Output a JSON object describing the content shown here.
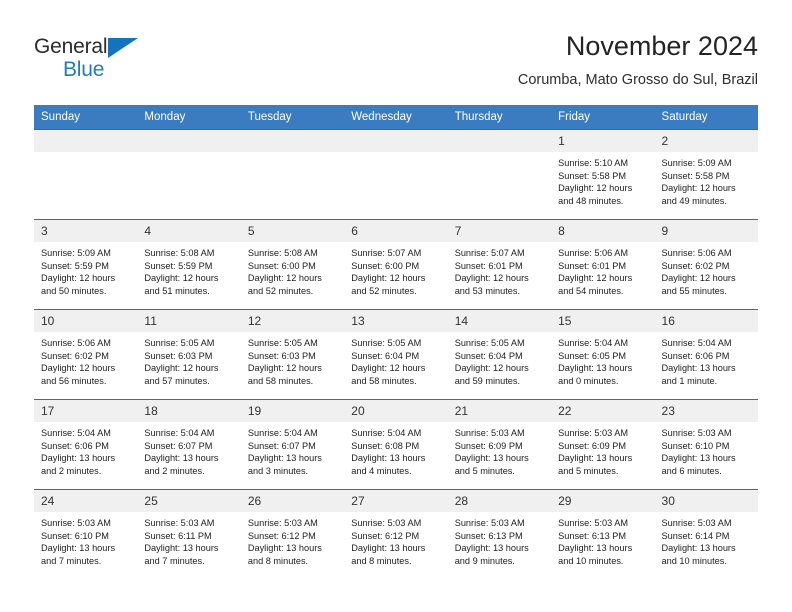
{
  "brand": {
    "name_top": "General",
    "name_bottom": "Blue",
    "color_dark": "#2b2b2b",
    "color_blue": "#1f7dc4"
  },
  "header": {
    "title": "November 2024",
    "subtitle": "Corumba, Mato Grosso do Sul, Brazil"
  },
  "theme": {
    "header_bg": "#3b7cc0",
    "row_border": "#2f6fab",
    "daynum_bg": "#f0f0f0"
  },
  "calendar": {
    "weekday_headers": [
      "Sunday",
      "Monday",
      "Tuesday",
      "Wednesday",
      "Thursday",
      "Friday",
      "Saturday"
    ],
    "weeks": [
      [
        {
          "day": "",
          "empty": true
        },
        {
          "day": "",
          "empty": true
        },
        {
          "day": "",
          "empty": true
        },
        {
          "day": "",
          "empty": true
        },
        {
          "day": "",
          "empty": true
        },
        {
          "day": "1",
          "sunrise": "Sunrise: 5:10 AM",
          "sunset": "Sunset: 5:58 PM",
          "daylight1": "Daylight: 12 hours",
          "daylight2": "and 48 minutes."
        },
        {
          "day": "2",
          "sunrise": "Sunrise: 5:09 AM",
          "sunset": "Sunset: 5:58 PM",
          "daylight1": "Daylight: 12 hours",
          "daylight2": "and 49 minutes."
        }
      ],
      [
        {
          "day": "3",
          "sunrise": "Sunrise: 5:09 AM",
          "sunset": "Sunset: 5:59 PM",
          "daylight1": "Daylight: 12 hours",
          "daylight2": "and 50 minutes."
        },
        {
          "day": "4",
          "sunrise": "Sunrise: 5:08 AM",
          "sunset": "Sunset: 5:59 PM",
          "daylight1": "Daylight: 12 hours",
          "daylight2": "and 51 minutes."
        },
        {
          "day": "5",
          "sunrise": "Sunrise: 5:08 AM",
          "sunset": "Sunset: 6:00 PM",
          "daylight1": "Daylight: 12 hours",
          "daylight2": "and 52 minutes."
        },
        {
          "day": "6",
          "sunrise": "Sunrise: 5:07 AM",
          "sunset": "Sunset: 6:00 PM",
          "daylight1": "Daylight: 12 hours",
          "daylight2": "and 52 minutes."
        },
        {
          "day": "7",
          "sunrise": "Sunrise: 5:07 AM",
          "sunset": "Sunset: 6:01 PM",
          "daylight1": "Daylight: 12 hours",
          "daylight2": "and 53 minutes."
        },
        {
          "day": "8",
          "sunrise": "Sunrise: 5:06 AM",
          "sunset": "Sunset: 6:01 PM",
          "daylight1": "Daylight: 12 hours",
          "daylight2": "and 54 minutes."
        },
        {
          "day": "9",
          "sunrise": "Sunrise: 5:06 AM",
          "sunset": "Sunset: 6:02 PM",
          "daylight1": "Daylight: 12 hours",
          "daylight2": "and 55 minutes."
        }
      ],
      [
        {
          "day": "10",
          "sunrise": "Sunrise: 5:06 AM",
          "sunset": "Sunset: 6:02 PM",
          "daylight1": "Daylight: 12 hours",
          "daylight2": "and 56 minutes."
        },
        {
          "day": "11",
          "sunrise": "Sunrise: 5:05 AM",
          "sunset": "Sunset: 6:03 PM",
          "daylight1": "Daylight: 12 hours",
          "daylight2": "and 57 minutes."
        },
        {
          "day": "12",
          "sunrise": "Sunrise: 5:05 AM",
          "sunset": "Sunset: 6:03 PM",
          "daylight1": "Daylight: 12 hours",
          "daylight2": "and 58 minutes."
        },
        {
          "day": "13",
          "sunrise": "Sunrise: 5:05 AM",
          "sunset": "Sunset: 6:04 PM",
          "daylight1": "Daylight: 12 hours",
          "daylight2": "and 58 minutes."
        },
        {
          "day": "14",
          "sunrise": "Sunrise: 5:05 AM",
          "sunset": "Sunset: 6:04 PM",
          "daylight1": "Daylight: 12 hours",
          "daylight2": "and 59 minutes."
        },
        {
          "day": "15",
          "sunrise": "Sunrise: 5:04 AM",
          "sunset": "Sunset: 6:05 PM",
          "daylight1": "Daylight: 13 hours",
          "daylight2": "and 0 minutes."
        },
        {
          "day": "16",
          "sunrise": "Sunrise: 5:04 AM",
          "sunset": "Sunset: 6:06 PM",
          "daylight1": "Daylight: 13 hours",
          "daylight2": "and 1 minute."
        }
      ],
      [
        {
          "day": "17",
          "sunrise": "Sunrise: 5:04 AM",
          "sunset": "Sunset: 6:06 PM",
          "daylight1": "Daylight: 13 hours",
          "daylight2": "and 2 minutes."
        },
        {
          "day": "18",
          "sunrise": "Sunrise: 5:04 AM",
          "sunset": "Sunset: 6:07 PM",
          "daylight1": "Daylight: 13 hours",
          "daylight2": "and 2 minutes."
        },
        {
          "day": "19",
          "sunrise": "Sunrise: 5:04 AM",
          "sunset": "Sunset: 6:07 PM",
          "daylight1": "Daylight: 13 hours",
          "daylight2": "and 3 minutes."
        },
        {
          "day": "20",
          "sunrise": "Sunrise: 5:04 AM",
          "sunset": "Sunset: 6:08 PM",
          "daylight1": "Daylight: 13 hours",
          "daylight2": "and 4 minutes."
        },
        {
          "day": "21",
          "sunrise": "Sunrise: 5:03 AM",
          "sunset": "Sunset: 6:09 PM",
          "daylight1": "Daylight: 13 hours",
          "daylight2": "and 5 minutes."
        },
        {
          "day": "22",
          "sunrise": "Sunrise: 5:03 AM",
          "sunset": "Sunset: 6:09 PM",
          "daylight1": "Daylight: 13 hours",
          "daylight2": "and 5 minutes."
        },
        {
          "day": "23",
          "sunrise": "Sunrise: 5:03 AM",
          "sunset": "Sunset: 6:10 PM",
          "daylight1": "Daylight: 13 hours",
          "daylight2": "and 6 minutes."
        }
      ],
      [
        {
          "day": "24",
          "sunrise": "Sunrise: 5:03 AM",
          "sunset": "Sunset: 6:10 PM",
          "daylight1": "Daylight: 13 hours",
          "daylight2": "and 7 minutes."
        },
        {
          "day": "25",
          "sunrise": "Sunrise: 5:03 AM",
          "sunset": "Sunset: 6:11 PM",
          "daylight1": "Daylight: 13 hours",
          "daylight2": "and 7 minutes."
        },
        {
          "day": "26",
          "sunrise": "Sunrise: 5:03 AM",
          "sunset": "Sunset: 6:12 PM",
          "daylight1": "Daylight: 13 hours",
          "daylight2": "and 8 minutes."
        },
        {
          "day": "27",
          "sunrise": "Sunrise: 5:03 AM",
          "sunset": "Sunset: 6:12 PM",
          "daylight1": "Daylight: 13 hours",
          "daylight2": "and 8 minutes."
        },
        {
          "day": "28",
          "sunrise": "Sunrise: 5:03 AM",
          "sunset": "Sunset: 6:13 PM",
          "daylight1": "Daylight: 13 hours",
          "daylight2": "and 9 minutes."
        },
        {
          "day": "29",
          "sunrise": "Sunrise: 5:03 AM",
          "sunset": "Sunset: 6:13 PM",
          "daylight1": "Daylight: 13 hours",
          "daylight2": "and 10 minutes."
        },
        {
          "day": "30",
          "sunrise": "Sunrise: 5:03 AM",
          "sunset": "Sunset: 6:14 PM",
          "daylight1": "Daylight: 13 hours",
          "daylight2": "and 10 minutes."
        }
      ]
    ]
  }
}
